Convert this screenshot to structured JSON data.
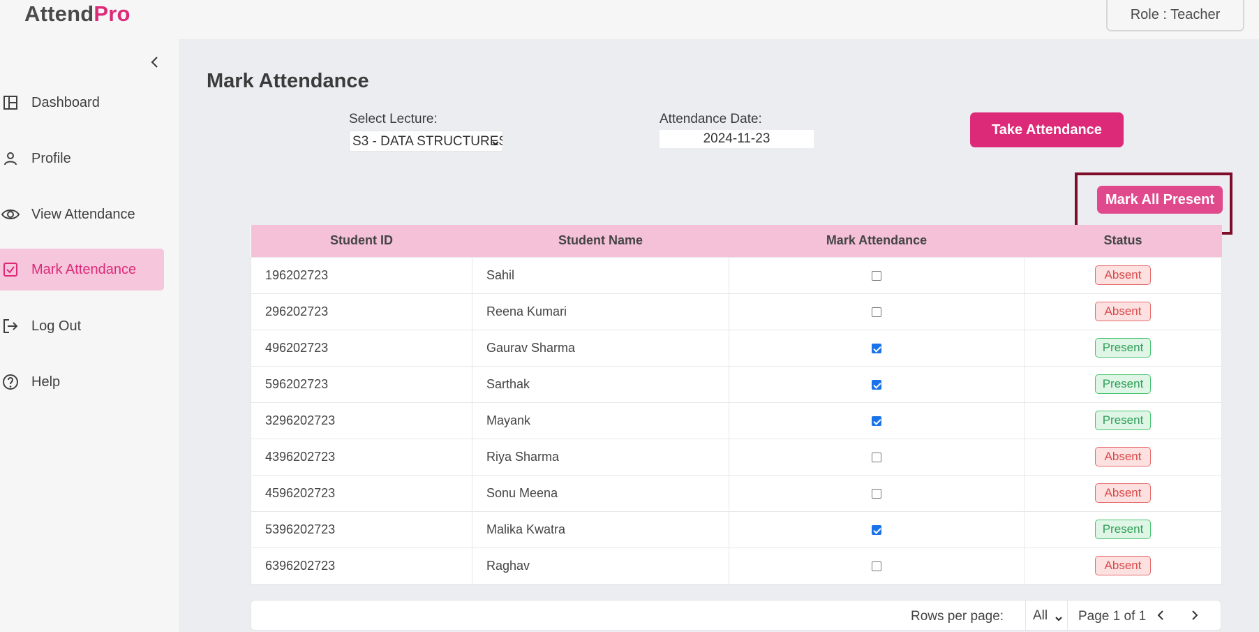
{
  "app": {
    "logo_part1": "Attend",
    "logo_part2": "Pro",
    "role": "Role : Teacher"
  },
  "sidebar": {
    "items": [
      {
        "label": "Dashboard",
        "icon": "layout-icon",
        "active": false
      },
      {
        "label": "Profile",
        "icon": "user-icon",
        "active": false
      },
      {
        "label": "View Attendance",
        "icon": "eye-icon",
        "active": false
      },
      {
        "label": "Mark Attendance",
        "icon": "check-square-icon",
        "active": true
      },
      {
        "label": "Log Out",
        "icon": "logout-icon",
        "active": false
      },
      {
        "label": "Help",
        "icon": "help-icon",
        "active": false
      }
    ]
  },
  "page": {
    "title": "Mark Attendance",
    "lecture_label": "Select Lecture:",
    "lecture_value": "S3 - DATA STRUCTURES",
    "date_label": "Attendance Date:",
    "date_value": "2024-11-23",
    "take_button": "Take Attendance",
    "mark_all_button": "Mark All Present"
  },
  "table": {
    "headers": [
      "Student ID",
      "Student Name",
      "Mark Attendance",
      "Status"
    ],
    "rows": [
      {
        "id": "196202723",
        "name": "Sahil",
        "checked": false,
        "status": "Absent"
      },
      {
        "id": "296202723",
        "name": "Reena Kumari",
        "checked": false,
        "status": "Absent"
      },
      {
        "id": "496202723",
        "name": "Gaurav Sharma",
        "checked": true,
        "status": "Present"
      },
      {
        "id": "596202723",
        "name": "Sarthak",
        "checked": true,
        "status": "Present"
      },
      {
        "id": "3296202723",
        "name": "Mayank",
        "checked": true,
        "status": "Present"
      },
      {
        "id": "4396202723",
        "name": "Riya Sharma",
        "checked": false,
        "status": "Absent"
      },
      {
        "id": "4596202723",
        "name": "Sonu Meena",
        "checked": false,
        "status": "Absent"
      },
      {
        "id": "5396202723",
        "name": "Malika Kwatra",
        "checked": true,
        "status": "Present"
      },
      {
        "id": "6396202723",
        "name": "Raghav",
        "checked": false,
        "status": "Absent"
      }
    ]
  },
  "pager": {
    "rows_label": "Rows per page:",
    "rows_value": "All",
    "page_text": "Page 1 of 1"
  },
  "colors": {
    "accent": "#dc2a78",
    "header_bg": "#f4c1d8",
    "absent": "#d94848",
    "present": "#2e9e57"
  }
}
